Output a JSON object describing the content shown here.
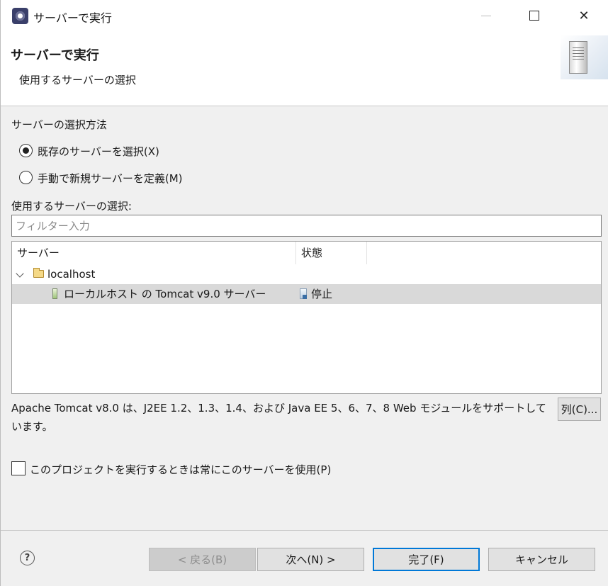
{
  "window": {
    "title": "サーバーで実行",
    "minimize_icon": "minimize-icon",
    "maximize_icon": "maximize-icon",
    "close_glyph": "✕"
  },
  "banner": {
    "title": "サーバーで実行",
    "description": "使用するサーバーの選択",
    "graphic": "server-graphic"
  },
  "selection_method": {
    "label": "サーバーの選択方法",
    "options": [
      {
        "label": "既存のサーバーを選択(X)",
        "checked": true
      },
      {
        "label": "手動で新規サーバーを定義(M)",
        "checked": false
      }
    ]
  },
  "server_select": {
    "label": "使用するサーバーの選択:",
    "filter_placeholder": "フィルター入力",
    "filter_value": ""
  },
  "tree": {
    "columns": [
      "サーバー",
      "状態"
    ],
    "rows": [
      {
        "name": "localhost",
        "status": "",
        "expanded": true,
        "icon": "folder-icon"
      },
      {
        "name": "ローカルホスト の Tomcat v9.0 サーバー",
        "status": "停止",
        "selected": true,
        "icon": "server-icon",
        "status_icon": "stopped-icon"
      }
    ]
  },
  "description": "Apache Tomcat v8.0 は、J2EE 1.2、1.3、1.4、および Java EE 5、6、7、8 Web モジュールをサポートしています。",
  "columns_button": "列(C)...",
  "always_use_checkbox": {
    "label": "このプロジェクトを実行するときは常にこのサーバーを使用(P)",
    "checked": false
  },
  "footer": {
    "help_glyph": "?",
    "back": "< 戻る(B)",
    "next": "次へ(N) >",
    "finish": "完了(F)",
    "cancel": "キャンセル"
  },
  "colors": {
    "window_bg": "#f0f0f0",
    "selected_row": "#d9d9d9",
    "default_button_border": "#0078d7"
  }
}
